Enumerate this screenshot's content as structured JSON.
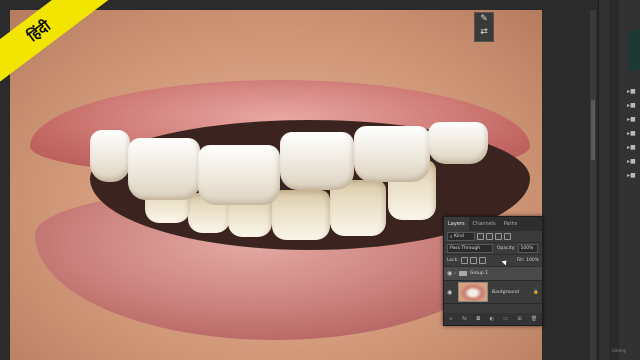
{
  "badge": {
    "text": "हिंदी"
  },
  "layers_panel": {
    "tabs": [
      "Layers",
      "Channels",
      "Paths"
    ],
    "kind_label": "Kind",
    "blend_mode": "Pass Through",
    "opacity_label": "Opacity:",
    "opacity_value": "100%",
    "lock_label": "Lock:",
    "fill_label": "Fill:",
    "fill_value": "100%",
    "layers": [
      {
        "name": "Group 1",
        "type": "group"
      },
      {
        "name": "Background",
        "type": "image"
      }
    ]
  },
  "colors": {
    "badge": "#f2e600",
    "panel_bg": "#3b3b3b",
    "workspace": "#2b2b2b"
  },
  "watermark": "Udemy"
}
